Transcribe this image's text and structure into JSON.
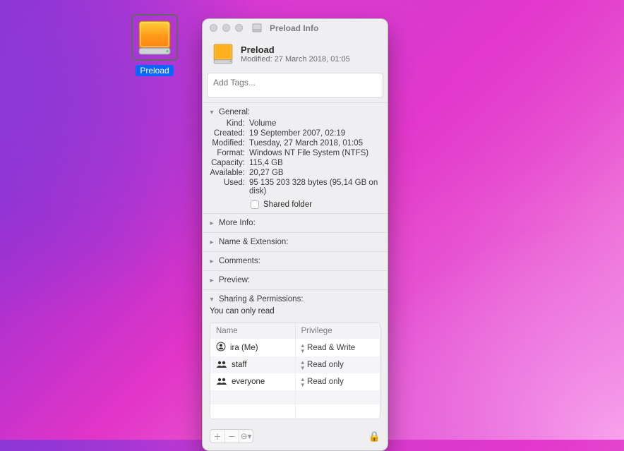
{
  "desktop": {
    "icon_label": "Preload"
  },
  "window": {
    "title": "Preload Info",
    "header_name": "Preload",
    "header_modified_label": "Modified:",
    "header_modified_value": "27 March 2018, 01:05",
    "tags_placeholder": "Add Tags..."
  },
  "sections": {
    "general": {
      "title": "General:",
      "rows": {
        "kind": {
          "k": "Kind:",
          "v": "Volume"
        },
        "created": {
          "k": "Created:",
          "v": "19 September 2007, 02:19"
        },
        "modified": {
          "k": "Modified:",
          "v": "Tuesday, 27 March 2018, 01:05"
        },
        "format": {
          "k": "Format:",
          "v": "Windows NT File System (NTFS)"
        },
        "capacity": {
          "k": "Capacity:",
          "v": "115,4 GB"
        },
        "available": {
          "k": "Available:",
          "v": "20,27 GB"
        },
        "used": {
          "k": "Used:",
          "v": "95 135 203 328 bytes (95,14 GB on disk)"
        }
      },
      "shared_label": "Shared folder"
    },
    "more_info": "More Info:",
    "name_ext": "Name & Extension:",
    "comments": "Comments:",
    "preview": "Preview:",
    "sharing": "Sharing & Permissions:"
  },
  "permissions": {
    "hint": "You can only read",
    "cols": {
      "name": "Name",
      "priv": "Privilege"
    },
    "rows": [
      {
        "name": "ira (Me)",
        "priv": "Read & Write",
        "icon": "person"
      },
      {
        "name": "staff",
        "priv": "Read only",
        "icon": "group"
      },
      {
        "name": "everyone",
        "priv": "Read only",
        "icon": "group"
      }
    ]
  }
}
